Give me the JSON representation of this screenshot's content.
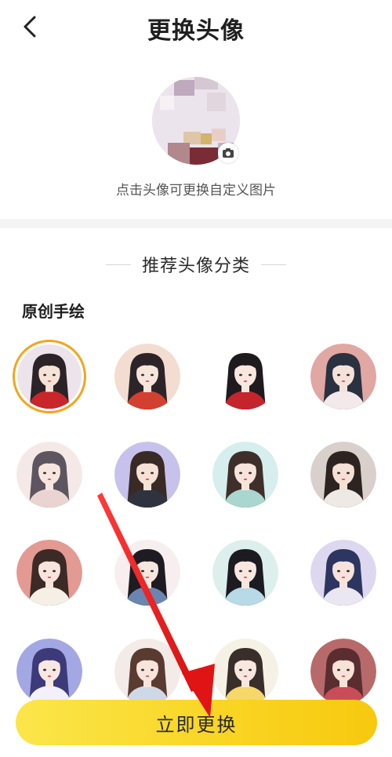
{
  "header": {
    "title": "更换头像",
    "back_icon": "chevron-left-icon"
  },
  "profile": {
    "hint": "点击头像可更换自定义图片",
    "camera_icon": "camera-icon"
  },
  "recommend": {
    "heading": "推荐头像分类",
    "categories": [
      {
        "name": "原创手绘",
        "avatars": [
          {
            "bg": "#ece4ea",
            "hair": "#2b2327",
            "skin": "#f6e3d8",
            "cloth": "#c8262a",
            "selected": true
          },
          {
            "bg": "#f2ddd0",
            "hair": "#2c2428",
            "skin": "#f7e5db",
            "cloth": "#d2402f",
            "selected": false
          },
          {
            "bg": "#ffffff",
            "hair": "#1f1a1e",
            "skin": "#f8e7df",
            "cloth": "#c4242c",
            "selected": false
          },
          {
            "bg": "#e1a7a2",
            "hair": "#2a3140",
            "skin": "#f5e2da",
            "cloth": "#f3e9ea",
            "selected": false
          },
          {
            "bg": "#f5e9e7",
            "hair": "#5d5560",
            "skin": "#f7e6de",
            "cloth": "#e9d4d2",
            "selected": false
          },
          {
            "bg": "#c7c2ec",
            "hair": "#3a2a26",
            "skin": "#f5e1d6",
            "cloth": "#2f3340",
            "selected": false
          },
          {
            "bg": "#d6eeee",
            "hair": "#3f2f2b",
            "skin": "#f6e4da",
            "cloth": "#a9d6cf",
            "selected": false
          },
          {
            "bg": "#d9cfcb",
            "hair": "#2d2421",
            "skin": "#f4e0d4",
            "cloth": "#eee9e4",
            "selected": false
          },
          {
            "bg": "#e39a93",
            "hair": "#3c2a26",
            "skin": "#f7e4dc",
            "cloth": "#f5efe6",
            "selected": false
          },
          {
            "bg": "#f7eef0",
            "hair": "#1e1c22",
            "skin": "#f7e6de",
            "cloth": "#6a86b0",
            "selected": false
          },
          {
            "bg": "#dcefec",
            "hair": "#1c1b21",
            "skin": "#f7e7df",
            "cloth": "#b8d9e6",
            "selected": false
          },
          {
            "bg": "#ddd8f0",
            "hair": "#2c3660",
            "skin": "#f6e3dc",
            "cloth": "#eae6f2",
            "selected": false
          },
          {
            "bg": "#a3a7e3",
            "hair": "#3d3a7a",
            "skin": "#f8e8e2",
            "cloth": "#f2f0fa",
            "selected": false
          },
          {
            "bg": "#f3ebe8",
            "hair": "#5a3b30",
            "skin": "#f7e5dc",
            "cloth": "#cfd8e6",
            "selected": false
          },
          {
            "bg": "#f6f1e5",
            "hair": "#3a2e2a",
            "skin": "#f8e7df",
            "cloth": "#f5d76a",
            "selected": false
          },
          {
            "bg": "#b86a6a",
            "hair": "#5a2e30",
            "skin": "#f7e2d8",
            "cloth": "#c94d58",
            "selected": false
          }
        ]
      }
    ]
  },
  "action": {
    "confirm_label": "立即更换"
  },
  "colors": {
    "accent": "#f8d02a",
    "selected_ring": "#f4a51f",
    "annotation_arrow": "#e51b1b"
  }
}
